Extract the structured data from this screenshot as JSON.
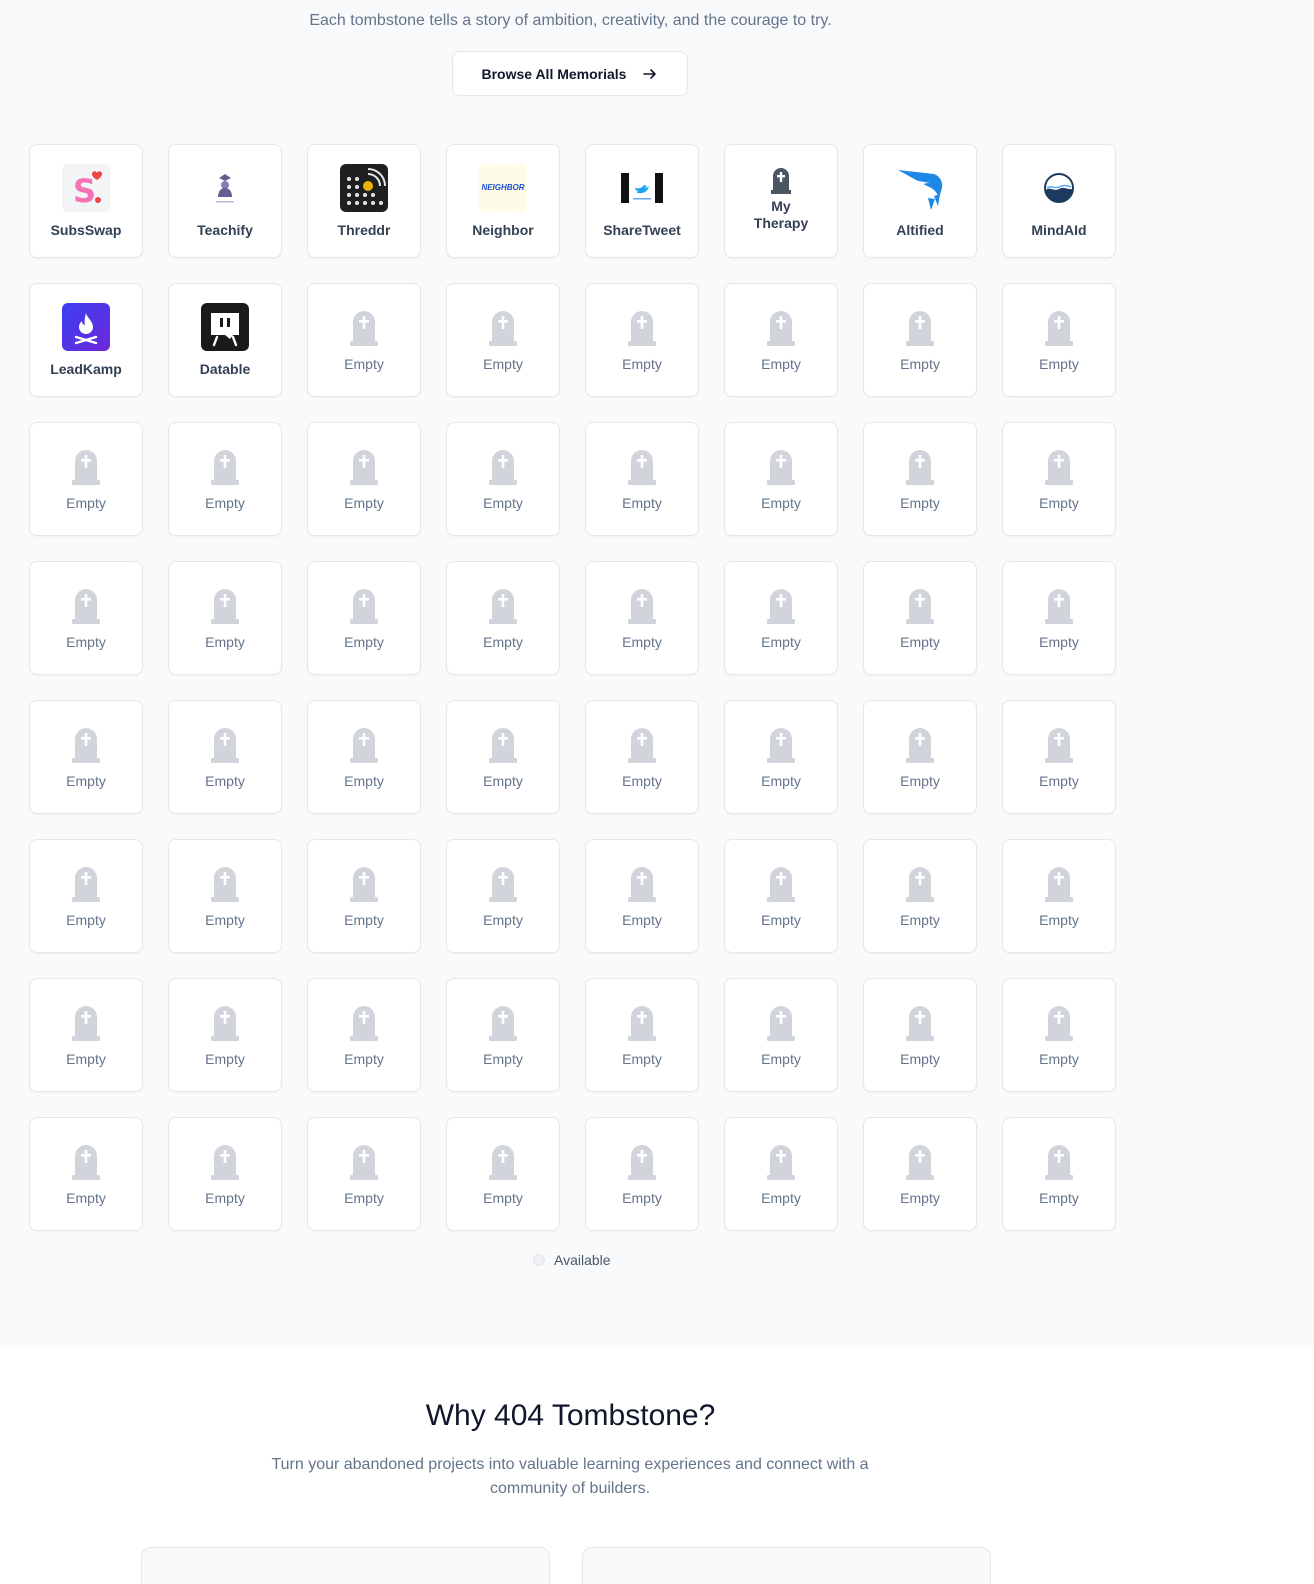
{
  "hero": {
    "tagline": "Each tombstone tells a story of ambition, creativity, and the courage to try.",
    "browse_label": "Browse All Memorials"
  },
  "projects": [
    {
      "name": "SubsSwap",
      "icon": "subsswap-logo"
    },
    {
      "name": "Teachify",
      "icon": "teachify-logo"
    },
    {
      "name": "Threddr",
      "icon": "threddr-logo"
    },
    {
      "name": "Neighbor",
      "icon": "neighbor-logo",
      "logo_text": "NEIGHBOR"
    },
    {
      "name": "ShareTweet",
      "icon": "sharetweet-logo"
    },
    {
      "name": "My Therapy",
      "icon": "tombstone-icon"
    },
    {
      "name": "Altified",
      "icon": "altified-logo"
    },
    {
      "name": "MindAId",
      "icon": "mindaid-logo"
    },
    {
      "name": "LeadKamp",
      "icon": "leadkamp-logo"
    },
    {
      "name": "Datable",
      "icon": "datable-logo"
    }
  ],
  "empty_label": "Empty",
  "empty_count": 54,
  "legend": {
    "available_label": "Available"
  },
  "why": {
    "title": "Why 404 Tombstone?",
    "subtitle": "Turn your abandoned projects into valuable learning experiences and connect with a community of builders."
  },
  "colors": {
    "subsswap": "#f9a8c4",
    "leadkamp": "#4f46e5",
    "altified": "#1e88e5",
    "tombstone": "#d1d5db"
  }
}
